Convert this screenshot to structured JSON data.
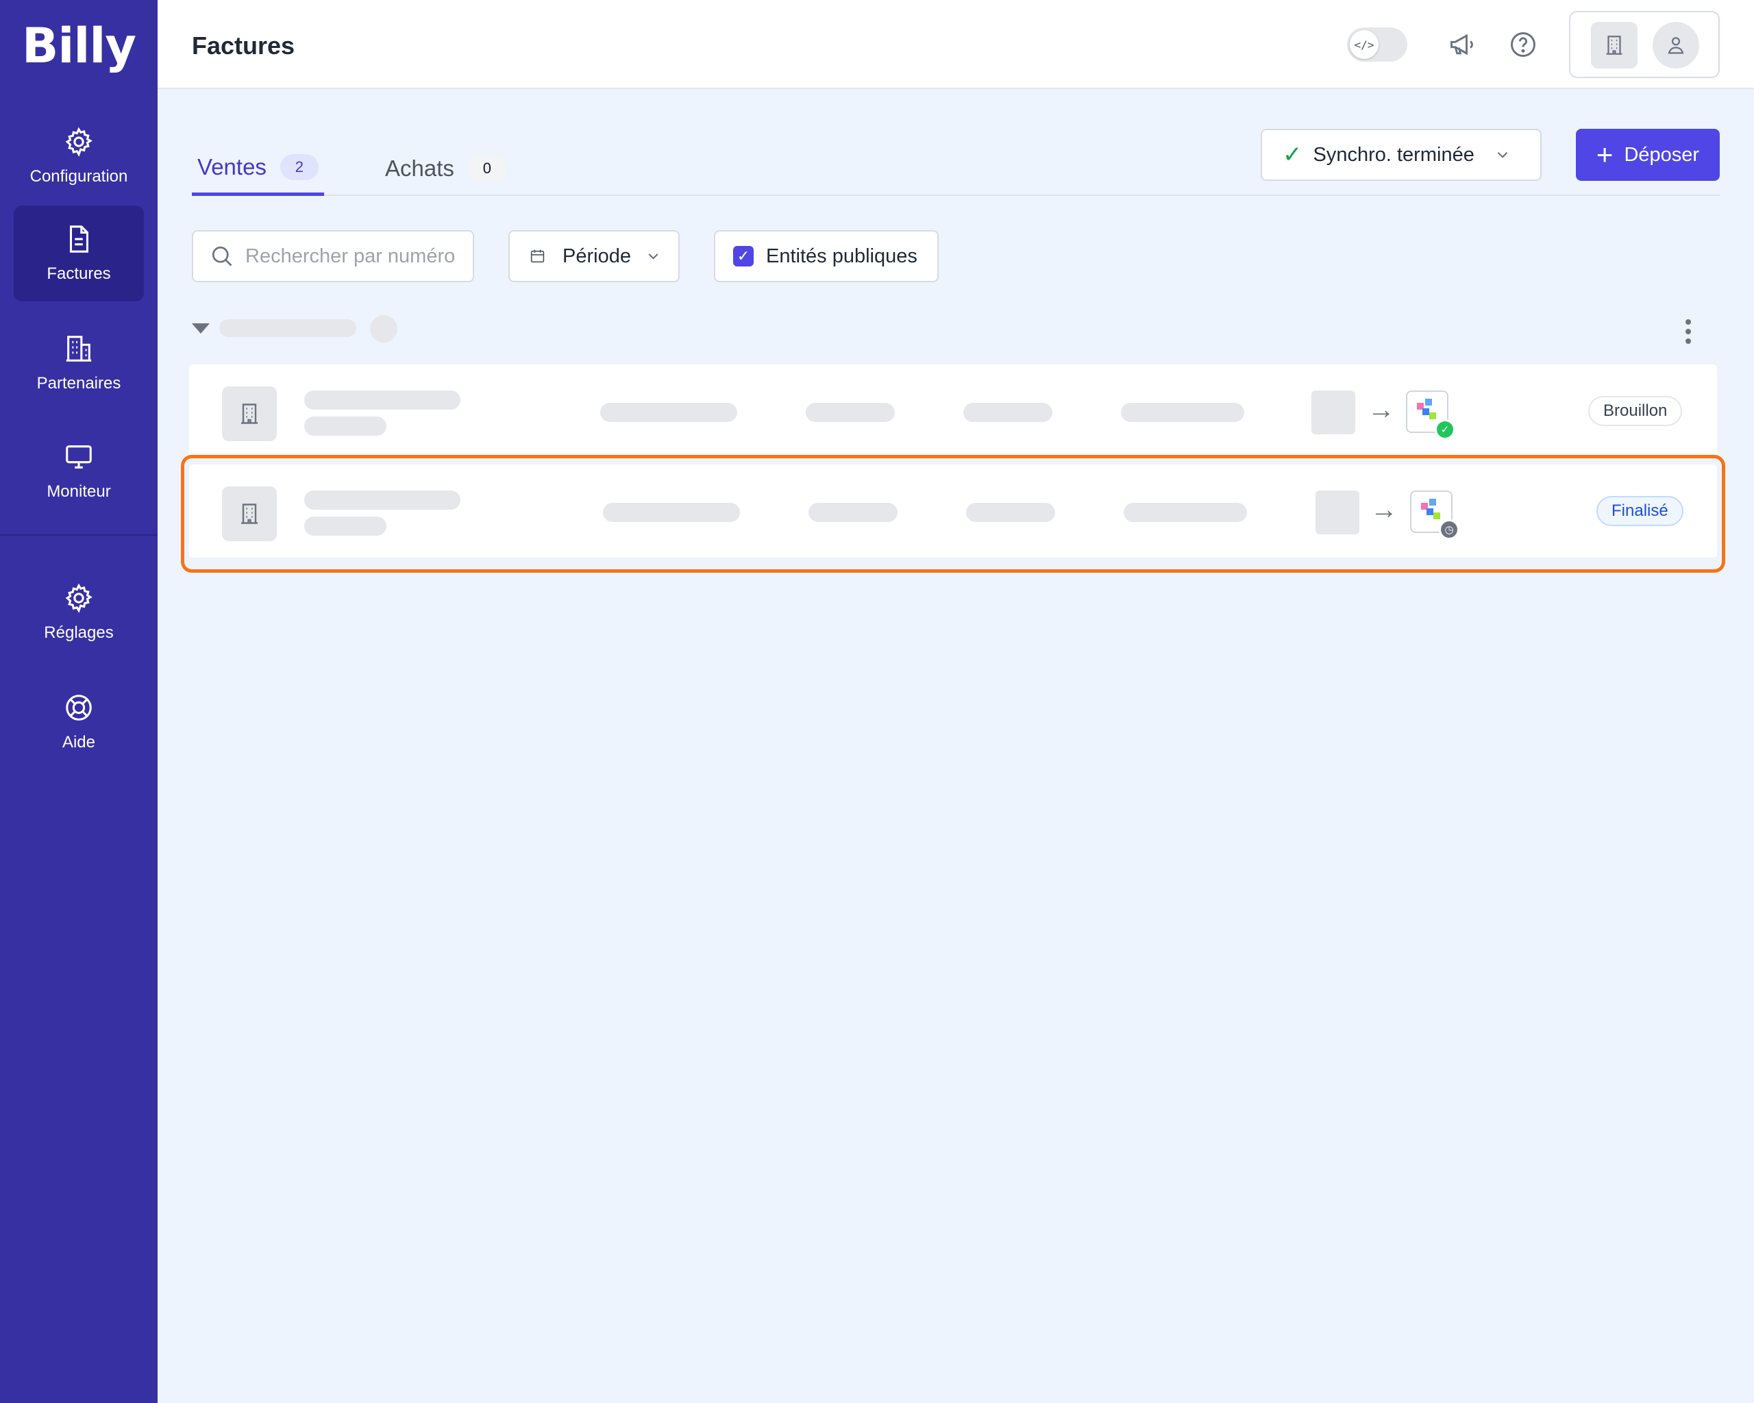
{
  "sidebar": {
    "logo": "Billy",
    "items": [
      {
        "label": "Configuration",
        "icon": "gear-icon"
      },
      {
        "label": "Factures",
        "icon": "document-icon",
        "active": true
      },
      {
        "label": "Partenaires",
        "icon": "building-icon"
      },
      {
        "label": "Moniteur",
        "icon": "monitor-icon"
      },
      {
        "label": "Réglages",
        "icon": "gear-icon"
      },
      {
        "label": "Aide",
        "icon": "lifebuoy-icon"
      }
    ]
  },
  "header": {
    "title": "Factures",
    "toggle_icon": "code-icon",
    "icons": [
      "megaphone-icon",
      "help-icon",
      "building-icon",
      "user-icon"
    ]
  },
  "tabs": [
    {
      "label": "Ventes",
      "count": "2",
      "active": true
    },
    {
      "label": "Achats",
      "count": "0",
      "active": false
    }
  ],
  "toolbar": {
    "sync_label": "Synchro. terminée",
    "deposit_label": "Déposer"
  },
  "filters": {
    "search_placeholder": "Rechercher par numéro",
    "period_label": "Période",
    "public_entities_label": "Entités publiques",
    "public_entities_checked": true
  },
  "rows": [
    {
      "status": "Brouillon",
      "sync_state": "success"
    },
    {
      "status": "Finalisé",
      "sync_state": "pending"
    }
  ],
  "colors": {
    "sidebar": "#3730A3",
    "accent": "#4F46E5",
    "highlight": "#F97316",
    "success": "#16a34a"
  }
}
